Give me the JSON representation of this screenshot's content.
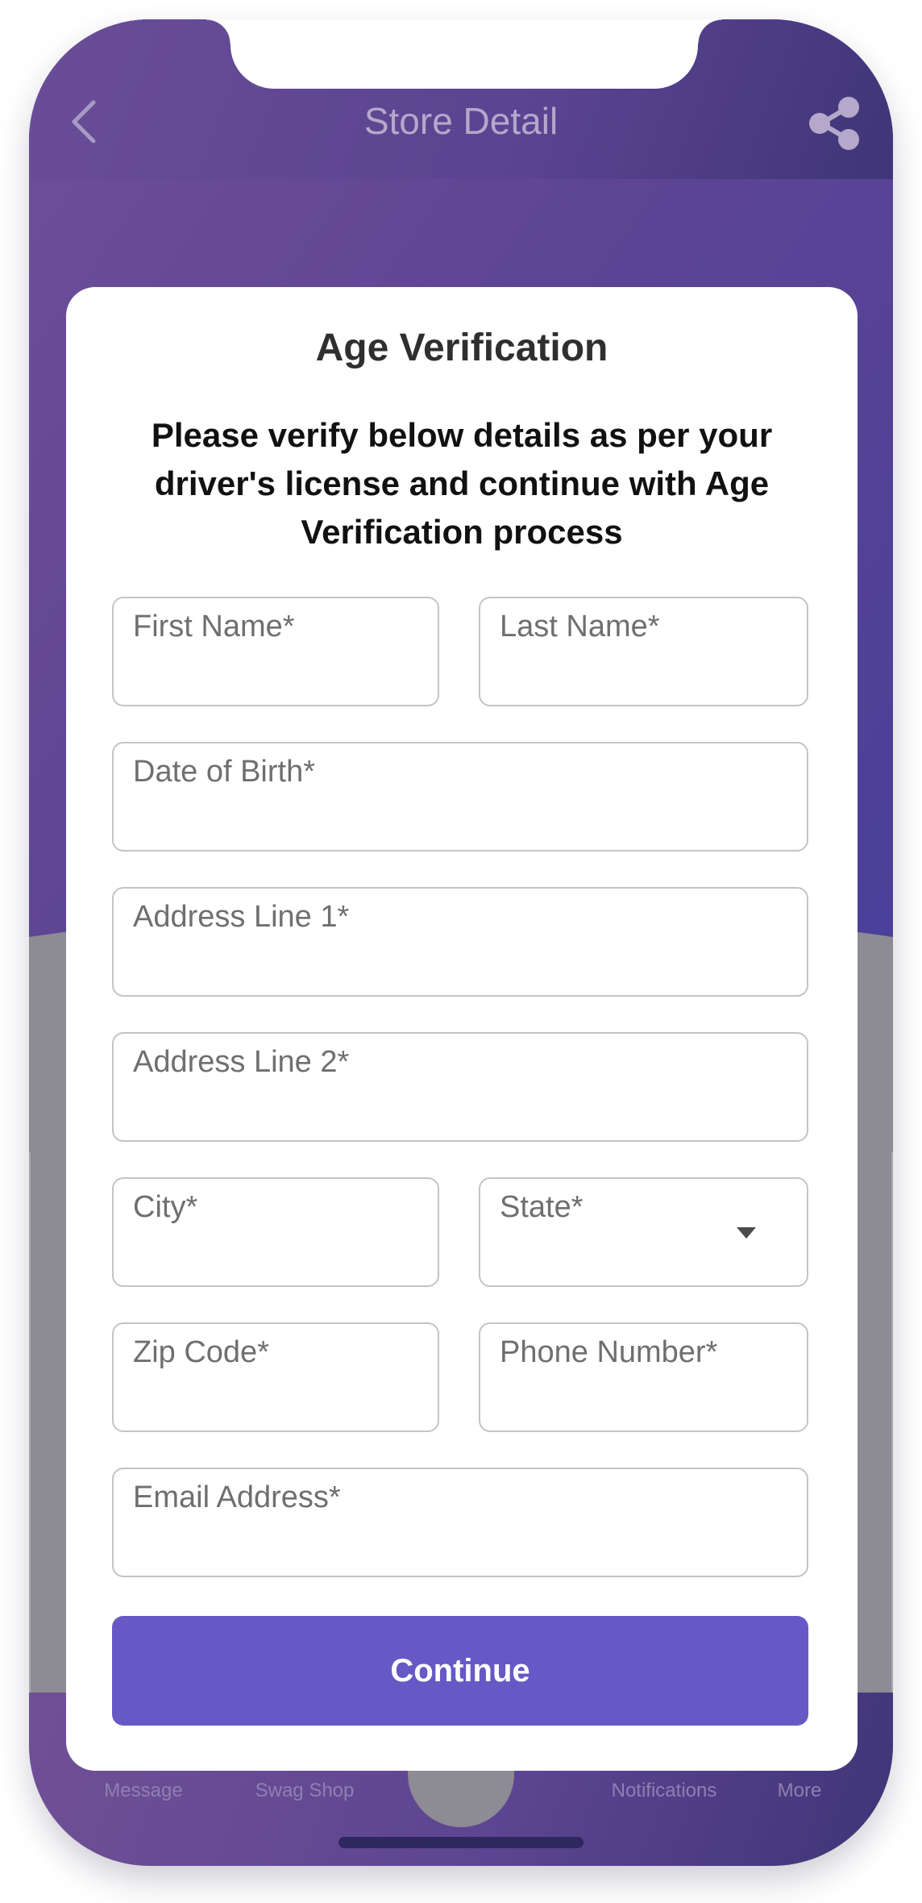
{
  "header": {
    "title": "Store Detail",
    "back_icon": "chevron-left-icon",
    "share_icon": "share-icon"
  },
  "modal": {
    "title": "Age Verification",
    "subtitle": "Please verify below details as per your driver's license and continue with Age Verification process",
    "fields": {
      "first_name": "First Name*",
      "last_name": "Last Name*",
      "date_of_birth": "Date of Birth*",
      "address_line_1": "Address Line 1*",
      "address_line_2": "Address Line 2*",
      "city": "City*",
      "state": "State*",
      "zip_code": "Zip Code*",
      "phone_number": "Phone Number*",
      "email_address": "Email Address*"
    },
    "continue_label": "Continue"
  },
  "bottom_nav": {
    "items": [
      {
        "label": "Message"
      },
      {
        "label": "Swag Shop"
      },
      {
        "label": "Notifications"
      },
      {
        "label": "More"
      }
    ]
  },
  "colors": {
    "header_gradient_start": "#6a4d98",
    "header_gradient_end": "#3f3578",
    "button": "#6659c5",
    "field_border": "#c4c4c4",
    "overlay_gray": "#8d8b93"
  }
}
